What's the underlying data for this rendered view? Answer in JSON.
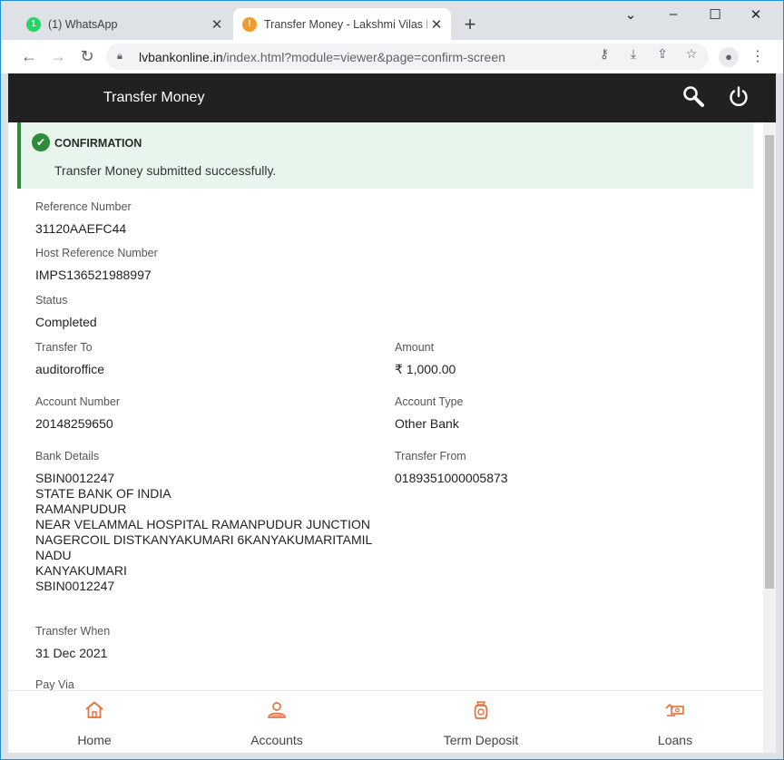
{
  "browser": {
    "tabs": [
      {
        "title": "(1) WhatsApp",
        "badge": "1",
        "active": false
      },
      {
        "title": "Transfer Money - Lakshmi Vilas B",
        "badge": "!",
        "active": true
      }
    ],
    "new_tab": "+",
    "url_host": "lvbankonline.in",
    "url_path": "/index.html?module=viewer&page=confirm-screen"
  },
  "appbar": {
    "title": "Transfer Money"
  },
  "alert": {
    "heading": "CONFIRMATION",
    "message": "Transfer Money submitted successfully.",
    "color": "#2e8b3a"
  },
  "details": {
    "reference_number": {
      "label": "Reference Number",
      "value": "31120AAEFC44"
    },
    "host_reference_number": {
      "label": "Host Reference Number",
      "value": "IMPS136521988997"
    },
    "status": {
      "label": "Status",
      "value": "Completed"
    },
    "transfer_to": {
      "label": "Transfer To",
      "value": "auditoroffice"
    },
    "amount": {
      "label": "Amount",
      "value": "₹ 1,000.00"
    },
    "account_number": {
      "label": "Account Number",
      "value": "20148259650"
    },
    "account_type": {
      "label": "Account Type",
      "value": "Other Bank"
    },
    "bank_details": {
      "label": "Bank Details",
      "lines": [
        "SBIN0012247",
        "STATE BANK OF INDIA",
        "RAMANPUDUR",
        "NEAR VELAMMAL HOSPITAL RAMANPUDUR JUNCTION",
        "NAGERCOIL DISTKANYAKUMARI 6KANYAKUMARITAMIL",
        "NADU",
        "KANYAKUMARI",
        "SBIN0012247"
      ]
    },
    "transfer_from": {
      "label": "Transfer From",
      "value": "0189351000005873"
    },
    "transfer_when": {
      "label": "Transfer When",
      "value": "31 Dec 2021"
    },
    "pay_via": {
      "label": "Pay Via"
    }
  },
  "bottom_nav": {
    "accent": "#e8703a",
    "items": [
      {
        "label": "Home",
        "icon": "home-icon"
      },
      {
        "label": "Accounts",
        "icon": "accounts-icon"
      },
      {
        "label": "Term Deposit",
        "icon": "term-deposit-icon"
      },
      {
        "label": "Loans",
        "icon": "loans-icon"
      }
    ]
  }
}
